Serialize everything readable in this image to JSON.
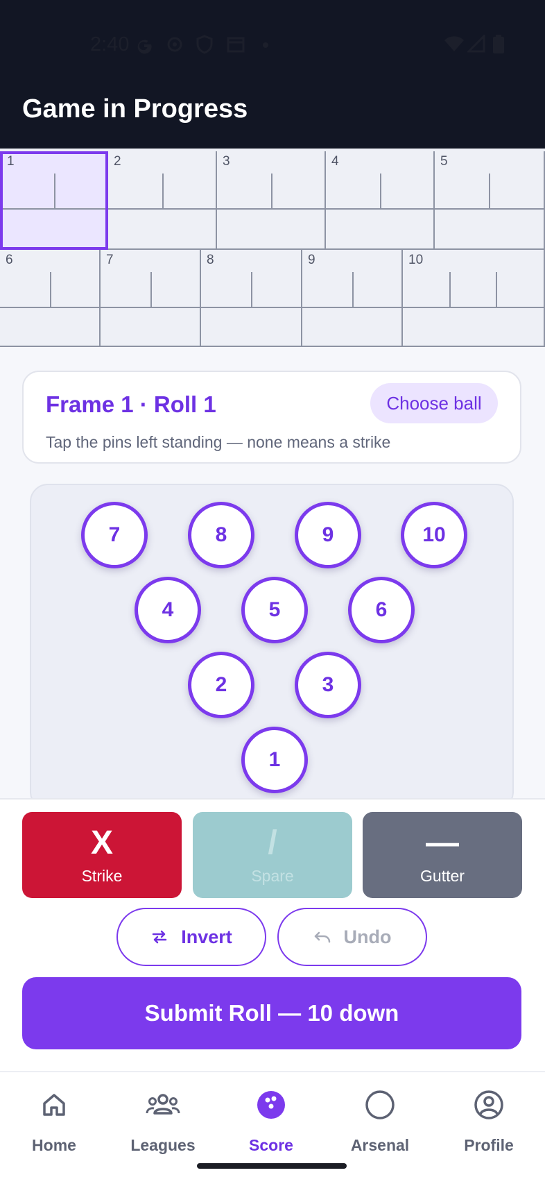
{
  "status_bar": {
    "time": "2:40"
  },
  "app_bar": {
    "title": "Game in Progress"
  },
  "scoreboard": {
    "frames": [
      "1",
      "2",
      "3",
      "4",
      "5",
      "6",
      "7",
      "8",
      "9",
      "10"
    ],
    "active_frame": "1"
  },
  "roll_card": {
    "title": "Frame 1 · Roll 1",
    "choose_ball_label": "Choose ball",
    "hint": "Tap the pins left standing — none means a strike"
  },
  "pins": {
    "p7": "7",
    "p8": "8",
    "p9": "9",
    "p10": "10",
    "p4": "4",
    "p5": "5",
    "p6": "6",
    "p2": "2",
    "p3": "3",
    "p1": "1"
  },
  "actions": {
    "strike_symbol": "X",
    "strike_label": "Strike",
    "spare_symbol": "/",
    "spare_label": "Spare",
    "gutter_symbol": "—",
    "gutter_label": "Gutter",
    "invert_label": "Invert",
    "undo_label": "Undo",
    "submit_label": "Submit Roll — 10 down"
  },
  "bottom_nav": {
    "items": [
      {
        "label": "Home",
        "icon": "home-icon"
      },
      {
        "label": "Leagues",
        "icon": "group-icon"
      },
      {
        "label": "Score",
        "icon": "bowling-ball-icon",
        "active": true
      },
      {
        "label": "Arsenal",
        "icon": "ring-icon"
      },
      {
        "label": "Profile",
        "icon": "profile-icon"
      }
    ]
  },
  "colors": {
    "primary": "#7c3aed",
    "strike": "#cc1536",
    "spare_disabled": "#9ccbcf",
    "gutter": "#686e80",
    "app_bar": "#121624"
  }
}
